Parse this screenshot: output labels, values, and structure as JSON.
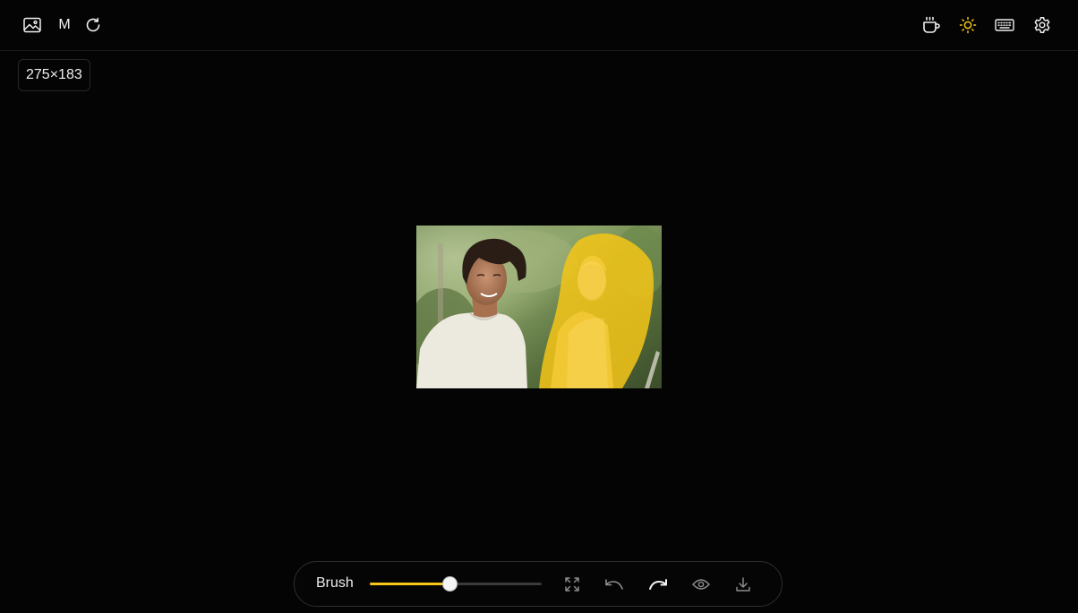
{
  "header": {
    "left_icons": [
      "image-icon",
      "mask-letter",
      "refresh-icon"
    ],
    "mode_letter": "M",
    "right_icons": [
      "coffee-icon",
      "sun-icon",
      "keyboard-icon",
      "settings-icon"
    ]
  },
  "image_size_label": "275×183",
  "toolbar": {
    "brush_label": "Brush",
    "brush_size_fraction": 0.47,
    "icons": [
      "fit-screen-icon",
      "undo-icon",
      "redo-icon",
      "eye-icon",
      "download-icon"
    ]
  },
  "colors": {
    "accent": "#f5c518",
    "background": "#040404"
  }
}
